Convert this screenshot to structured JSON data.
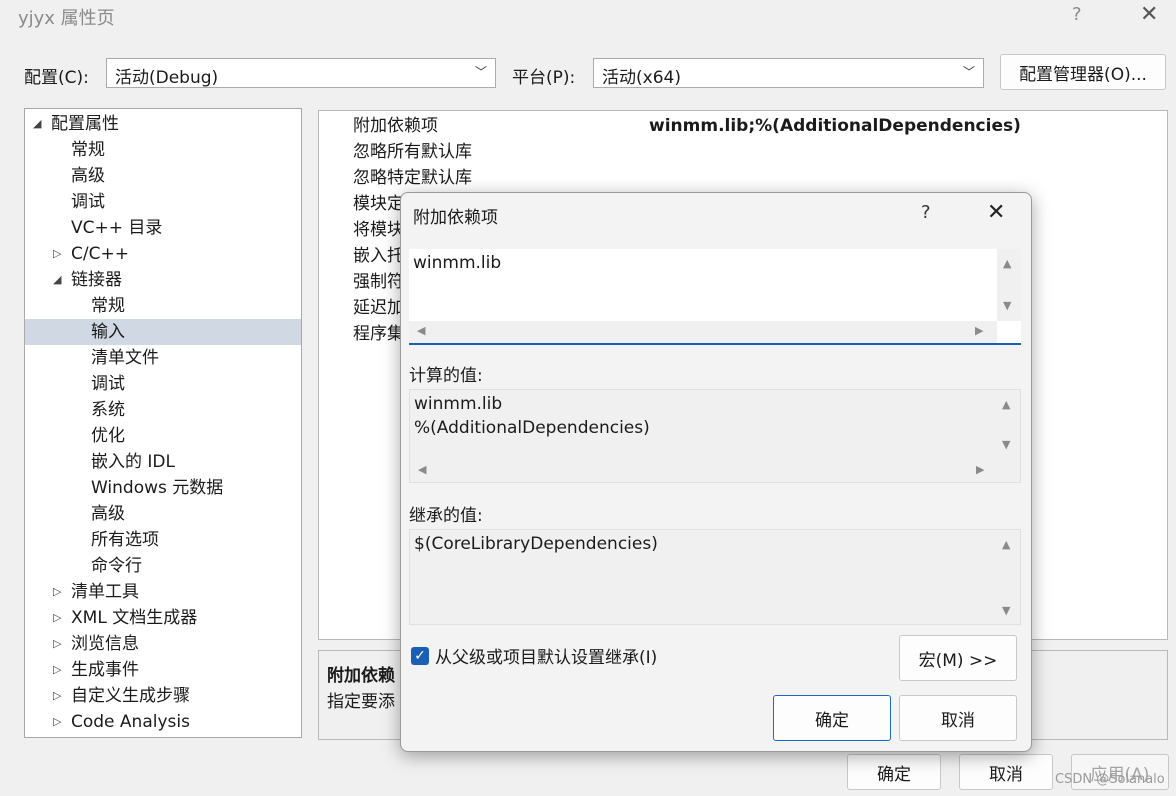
{
  "window": {
    "title": "yjyx 属性页",
    "help": "?",
    "close": "✕"
  },
  "toolbar": {
    "config_label": "配置(C):",
    "config_value": "活动(Debug)",
    "platform_label": "平台(P):",
    "platform_value": "活动(x64)",
    "config_manager": "配置管理器(O)..."
  },
  "tree": [
    {
      "label": "配置属性",
      "level": 0,
      "arrow": "◢",
      "selected": false
    },
    {
      "label": "常规",
      "level": 1,
      "arrow": "",
      "selected": false
    },
    {
      "label": "高级",
      "level": 1,
      "arrow": "",
      "selected": false
    },
    {
      "label": "调试",
      "level": 1,
      "arrow": "",
      "selected": false
    },
    {
      "label": "VC++ 目录",
      "level": 1,
      "arrow": "",
      "selected": false
    },
    {
      "label": "C/C++",
      "level": 1,
      "arrow": "▷",
      "selected": false
    },
    {
      "label": "链接器",
      "level": 1,
      "arrow": "◢",
      "selected": false
    },
    {
      "label": "常规",
      "level": 2,
      "arrow": "",
      "selected": false
    },
    {
      "label": "输入",
      "level": 2,
      "arrow": "",
      "selected": true
    },
    {
      "label": "清单文件",
      "level": 2,
      "arrow": "",
      "selected": false
    },
    {
      "label": "调试",
      "level": 2,
      "arrow": "",
      "selected": false
    },
    {
      "label": "系统",
      "level": 2,
      "arrow": "",
      "selected": false
    },
    {
      "label": "优化",
      "level": 2,
      "arrow": "",
      "selected": false
    },
    {
      "label": "嵌入的 IDL",
      "level": 2,
      "arrow": "",
      "selected": false
    },
    {
      "label": "Windows 元数据",
      "level": 2,
      "arrow": "",
      "selected": false
    },
    {
      "label": "高级",
      "level": 2,
      "arrow": "",
      "selected": false
    },
    {
      "label": "所有选项",
      "level": 2,
      "arrow": "",
      "selected": false
    },
    {
      "label": "命令行",
      "level": 2,
      "arrow": "",
      "selected": false
    },
    {
      "label": "清单工具",
      "level": 1,
      "arrow": "▷",
      "selected": false
    },
    {
      "label": "XML 文档生成器",
      "level": 1,
      "arrow": "▷",
      "selected": false
    },
    {
      "label": "浏览信息",
      "level": 1,
      "arrow": "▷",
      "selected": false
    },
    {
      "label": "生成事件",
      "level": 1,
      "arrow": "▷",
      "selected": false
    },
    {
      "label": "自定义生成步骤",
      "level": 1,
      "arrow": "▷",
      "selected": false
    },
    {
      "label": "Code Analysis",
      "level": 1,
      "arrow": "▷",
      "selected": false
    }
  ],
  "grid": {
    "rows": [
      {
        "name": "附加依赖项",
        "value": "winmm.lib;%(AdditionalDependencies)"
      },
      {
        "name": "忽略所有默认库",
        "value": ""
      },
      {
        "name": "忽略特定默认库",
        "value": ""
      },
      {
        "name": "模块定",
        "value": ""
      },
      {
        "name": "将模块",
        "value": ""
      },
      {
        "name": "嵌入托",
        "value": ""
      },
      {
        "name": "强制符",
        "value": ""
      },
      {
        "name": "延迟加",
        "value": ""
      },
      {
        "name": "程序集",
        "value": ""
      }
    ]
  },
  "description": {
    "title": "附加依赖",
    "text": "指定要添"
  },
  "dialog": {
    "title": "附加依赖项",
    "help": "?",
    "close": "✕",
    "edit_value": "winmm.lib",
    "computed_label": "计算的值:",
    "computed_lines": [
      "winmm.lib",
      "%(AdditionalDependencies)"
    ],
    "inherited_label": "继承的值:",
    "inherited_value": "$(CoreLibraryDependencies)",
    "inherit_checkbox_label": "从父级或项目默认设置继承(I)",
    "inherit_checked": true,
    "macro_button": "宏(M) >>",
    "ok_button": "确定",
    "cancel_button": "取消"
  },
  "footer": {
    "ok": "确定",
    "cancel": "取消",
    "apply": "应用(A)"
  },
  "watermark": "CSDN @Solanalo"
}
